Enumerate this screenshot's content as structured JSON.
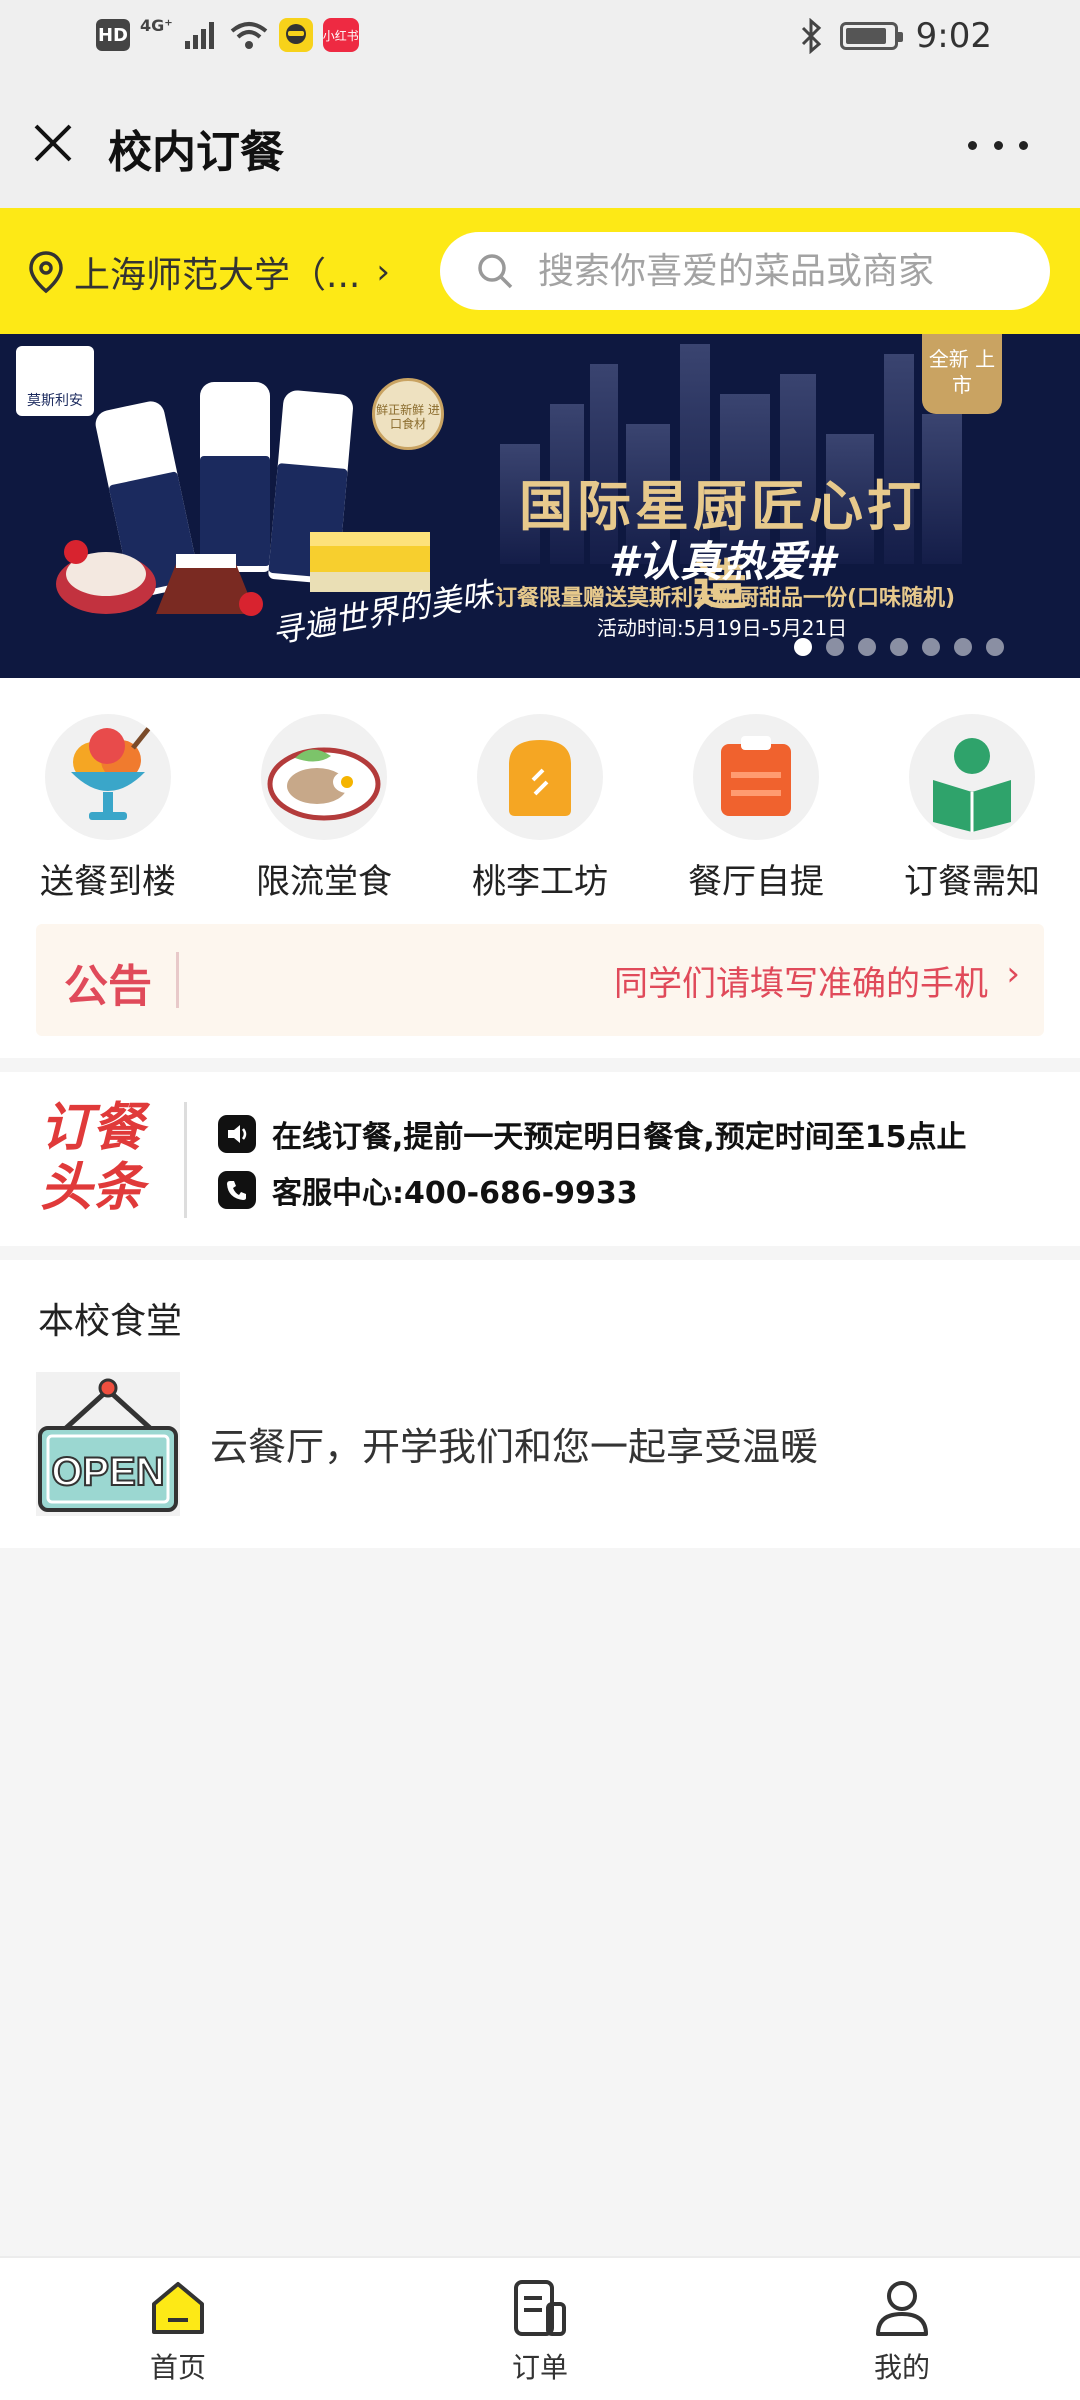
{
  "status_bar": {
    "hd": "HD",
    "network": "4G⁺",
    "app2": "小红书",
    "time": "9:02"
  },
  "header": {
    "title": "校内订餐"
  },
  "location": {
    "text": "上海师范大学（..."
  },
  "search": {
    "placeholder": "搜索你喜爱的菜品或商家"
  },
  "banner": {
    "brand": "莫斯利安",
    "new_badge": "全新 上市",
    "seal": "鲜正新鲜 进口食材",
    "headline": "国际星厨匠心打造",
    "hashtag": "#认真热爱#",
    "promo": "订餐限量赠送莫斯利安新厨甜品一份(口味随机)",
    "dates": "活动时间:5月19日-5月21日",
    "handwriting": "寻遍世界的美味",
    "slides": 7,
    "active_slide": 1
  },
  "categories": [
    {
      "label": "送餐到楼",
      "icon": "ice-cream-icon"
    },
    {
      "label": "限流堂食",
      "icon": "plate-icon"
    },
    {
      "label": "桃李工坊",
      "icon": "bread-icon"
    },
    {
      "label": "餐厅自提",
      "icon": "bag-icon"
    },
    {
      "label": "订餐需知",
      "icon": "reading-icon"
    }
  ],
  "notice": {
    "tag": "公告",
    "text": "同学们请填写准确的手机"
  },
  "headline": {
    "logo_line1": "订餐",
    "logo_line2": "头条",
    "item1": "在线订餐,提前一天预定明日餐食,预定时间至15点止",
    "item2": "客服中心:400-686-9933"
  },
  "canteen": {
    "section_title": "本校食堂",
    "image_text": "OPEN",
    "name": "云餐厅，开学我们和您一起享受温暖"
  },
  "tabs": [
    {
      "label": "首页",
      "icon": "home-icon"
    },
    {
      "label": "订单",
      "icon": "order-icon"
    },
    {
      "label": "我的",
      "icon": "profile-icon"
    }
  ],
  "colors": {
    "accent": "#fde916",
    "notice": "#e04a5a",
    "headline_red": "#e03a3a",
    "banner_bg": "#0e1840",
    "gold": "#e7c98c"
  }
}
